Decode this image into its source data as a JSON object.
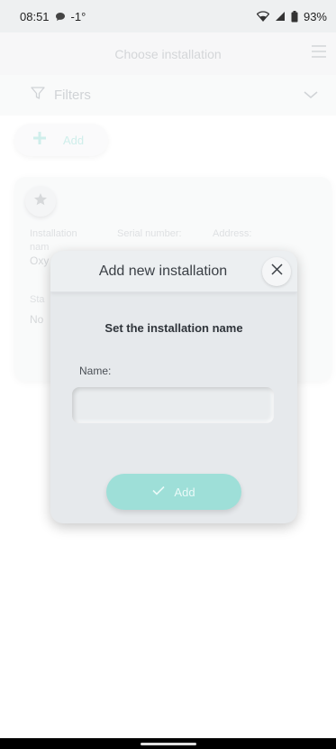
{
  "status_bar": {
    "time": "08:51",
    "temperature": "-1°",
    "battery": "93%",
    "icons": [
      "chat-icon",
      "wifi-icon",
      "signal-icon",
      "battery-icon"
    ]
  },
  "header": {
    "title": "Choose installation",
    "menu_icon": "menu-icon"
  },
  "filters": {
    "label": "Filters",
    "icon": "filter-icon",
    "chevron_icon": "chevron-down-icon"
  },
  "add_pill": {
    "label": "Add",
    "icon": "plus-icon"
  },
  "installation_card": {
    "star_icon": "star-icon",
    "installation_name_label": "Installation",
    "installation_name_label_2": "nam",
    "serial_label": "Serial number:",
    "address_label": "Address:",
    "name_value": "Oxy",
    "status_label": "Sta",
    "status_value": "No"
  },
  "modal": {
    "title": "Add new installation",
    "subtitle": "Set the installation name",
    "name_label": "Name:",
    "name_value": "",
    "name_placeholder": "",
    "add_label": "Add",
    "close_icon": "close-icon",
    "check_icon": "check-icon"
  },
  "colors": {
    "accent": "#9edfd8",
    "accent_light": "#bfe8e4",
    "modal_bg": "#e6e9ec",
    "status_bar_bg": "#eef0f1"
  }
}
